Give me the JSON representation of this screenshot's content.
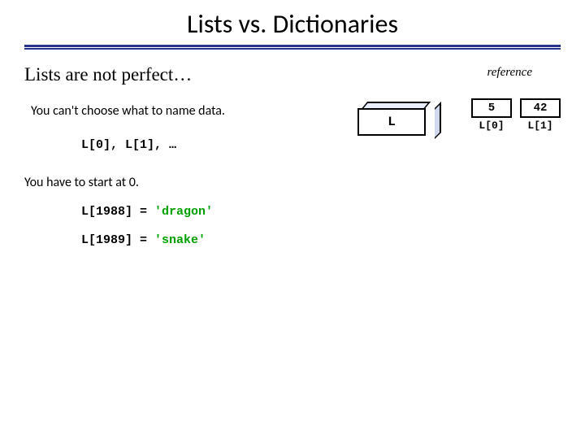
{
  "title": "Lists vs. Dictionaries",
  "subtitle": "Lists are not perfect…",
  "reference_label": "reference",
  "bullet1": "You can't choose what to name data.",
  "code_indices": "L[0], L[1], …",
  "bullet2": "You have to start at 0.",
  "assign1_lhs": "L[1988] = ",
  "assign1_rhs": "'dragon'",
  "assign2_lhs": "L[1989] = ",
  "assign2_rhs": "'snake'",
  "box_label": "L",
  "cells": [
    {
      "value": "5",
      "label": "L[0]"
    },
    {
      "value": "42",
      "label": "L[1]"
    }
  ]
}
